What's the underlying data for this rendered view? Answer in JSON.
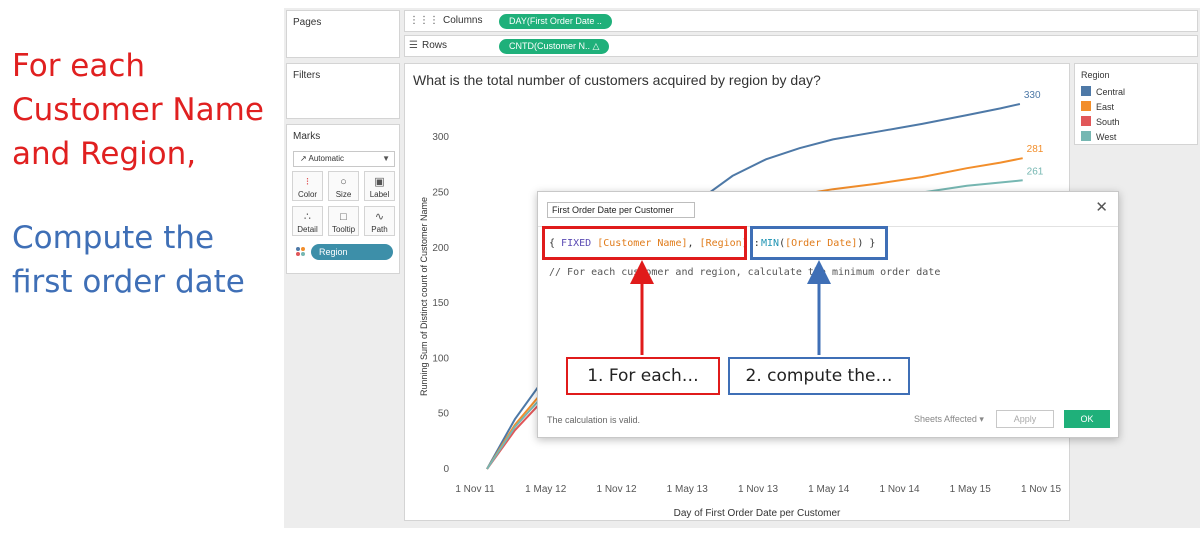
{
  "annotations": {
    "red_text": "For each Customer Name and Region,",
    "blue_text": "Compute the first order date"
  },
  "shelves": {
    "pages_label": "Pages",
    "columns_label": "Columns",
    "rows_label": "Rows",
    "columns_pill": "DAY(First Order Date ..",
    "rows_pill": "CNTD(Customer N..",
    "rows_pill_icon": "delta-icon",
    "filters_label": "Filters"
  },
  "marks": {
    "title": "Marks",
    "mark_type": "Automatic",
    "buttons": [
      "Color",
      "Size",
      "Label",
      "Detail",
      "Tooltip",
      "Path"
    ],
    "region_pill": "Region"
  },
  "legend": {
    "title": "Region",
    "items": [
      {
        "label": "Central",
        "color": "#4e79a7"
      },
      {
        "label": "East",
        "color": "#f28e2b"
      },
      {
        "label": "South",
        "color": "#e15759"
      },
      {
        "label": "West",
        "color": "#76b7b2"
      }
    ]
  },
  "chart_data": {
    "type": "line",
    "title": "What is the total number of customers acquired by region by day?",
    "xlabel": "Day of First Order Date per Customer",
    "ylabel": "Running Sum of Distinct count of Customer Name",
    "x_ticks": [
      "1 Nov 11",
      "1 May 12",
      "1 Nov 12",
      "1 May 13",
      "1 Nov 13",
      "1 May 14",
      "1 Nov 14",
      "1 May 15",
      "1 Nov 15"
    ],
    "y_ticks": [
      0,
      50,
      100,
      150,
      200,
      250,
      300
    ],
    "ylim": [
      0,
      330
    ],
    "series": [
      {
        "name": "Central",
        "color": "#4e79a7",
        "end_label": "330",
        "points": [
          [
            0,
            0
          ],
          [
            0.05,
            45
          ],
          [
            0.1,
            80
          ],
          [
            0.15,
            95
          ],
          [
            0.22,
            115
          ],
          [
            0.28,
            165
          ],
          [
            0.33,
            210
          ],
          [
            0.38,
            243
          ],
          [
            0.44,
            265
          ],
          [
            0.5,
            280
          ],
          [
            0.56,
            290
          ],
          [
            0.62,
            298
          ],
          [
            0.7,
            305
          ],
          [
            0.78,
            312
          ],
          [
            0.86,
            320
          ],
          [
            0.92,
            326
          ],
          [
            0.955,
            330
          ]
        ]
      },
      {
        "name": "East",
        "color": "#f28e2b",
        "end_label": "281",
        "points": [
          [
            0,
            0
          ],
          [
            0.05,
            40
          ],
          [
            0.1,
            70
          ],
          [
            0.15,
            88
          ],
          [
            0.22,
            105
          ],
          [
            0.28,
            150
          ],
          [
            0.33,
            190
          ],
          [
            0.38,
            210
          ],
          [
            0.44,
            228
          ],
          [
            0.5,
            240
          ],
          [
            0.56,
            248
          ],
          [
            0.62,
            253
          ],
          [
            0.7,
            258
          ],
          [
            0.78,
            264
          ],
          [
            0.86,
            272
          ],
          [
            0.92,
            277
          ],
          [
            0.96,
            281
          ]
        ]
      },
      {
        "name": "South",
        "color": "#e15759",
        "end_label": "",
        "points": [
          [
            0,
            0
          ],
          [
            0.05,
            35
          ],
          [
            0.1,
            62
          ],
          [
            0.15,
            80
          ],
          [
            0.22,
            95
          ],
          [
            0.28,
            130
          ],
          [
            0.33,
            160
          ]
        ]
      },
      {
        "name": "West",
        "color": "#76b7b2",
        "end_label": "261",
        "points": [
          [
            0,
            0
          ],
          [
            0.05,
            38
          ],
          [
            0.1,
            66
          ],
          [
            0.15,
            84
          ],
          [
            0.22,
            100
          ],
          [
            0.28,
            140
          ],
          [
            0.33,
            175
          ],
          [
            0.38,
            200
          ],
          [
            0.44,
            215
          ],
          [
            0.5,
            225
          ],
          [
            0.56,
            232
          ],
          [
            0.62,
            238
          ],
          [
            0.7,
            244
          ],
          [
            0.78,
            250
          ],
          [
            0.86,
            256
          ],
          [
            0.92,
            259
          ],
          [
            0.96,
            261
          ]
        ]
      }
    ]
  },
  "dialog": {
    "calc_name": "First Order Date per Customer",
    "code_open": "{ ",
    "code_fixed": "FIXED",
    "code_sp1": " ",
    "code_field1": "[Customer Name]",
    "code_comma": ", ",
    "code_field2": "[Region]",
    "code_colon": ":",
    "code_min": "MIN",
    "code_paren_open": "(",
    "code_field3": "[Order Date]",
    "code_paren_close": ") }",
    "comment": "// For each customer and region, calculate the minimum order date",
    "status": "The calculation is valid.",
    "sheets_affected": "Sheets Affected",
    "apply": "Apply",
    "ok": "OK"
  },
  "callouts": {
    "red": "1. For each…",
    "blue": "2. compute the…"
  }
}
